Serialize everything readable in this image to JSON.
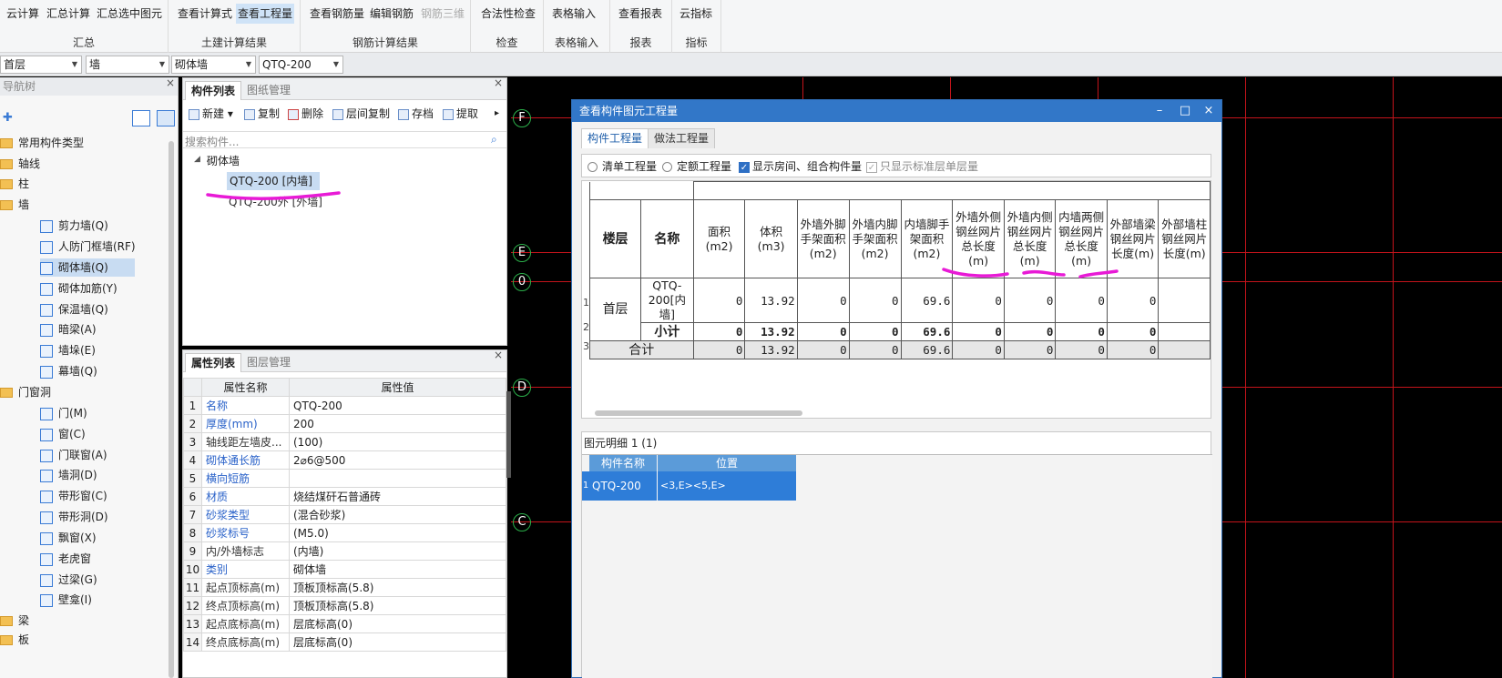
{
  "ribbon": {
    "groups": [
      {
        "label": "汇总",
        "buttons": [
          "云计算",
          "汇总计算",
          "汇总选中图元"
        ]
      },
      {
        "label": "土建计算结果",
        "buttons": [
          "查看计算式",
          "查看工程量"
        ]
      },
      {
        "label": "钢筋计算结果",
        "buttons": [
          "查看钢筋量",
          "编辑钢筋",
          "钢筋三维"
        ]
      },
      {
        "label": "检查",
        "buttons": [
          "合法性检查"
        ]
      },
      {
        "label": "表格输入",
        "buttons": [
          "表格输入"
        ]
      },
      {
        "label": "报表",
        "buttons": [
          "查看报表"
        ]
      },
      {
        "label": "指标",
        "buttons": [
          "云指标"
        ]
      }
    ]
  },
  "selectors": {
    "floor": "首层",
    "category": "墙",
    "type": "砌体墙",
    "component": "QTQ-200"
  },
  "nav": {
    "title": "导航树",
    "items": [
      "常用构件类型",
      "轴线",
      "柱",
      "墙",
      "剪力墙(Q)",
      "人防门框墙(RF)",
      "砌体墙(Q)",
      "砌体加筋(Y)",
      "保温墙(Q)",
      "暗梁(A)",
      "墙垛(E)",
      "幕墙(Q)",
      "门窗洞",
      "门(M)",
      "窗(C)",
      "门联窗(A)",
      "墙洞(D)",
      "带形窗(C)",
      "带形洞(D)",
      "飘窗(X)",
      "老虎窗",
      "过梁(G)",
      "壁龛(I)",
      "梁",
      "板"
    ]
  },
  "component_list": {
    "tab_active": "构件列表",
    "tab_other": "图纸管理",
    "toolbar": [
      "新建",
      "复制",
      "删除",
      "层间复制",
      "存档",
      "提取"
    ],
    "search_placeholder": "搜索构件...",
    "group": "砌体墙",
    "items": [
      "QTQ-200 [内墙]",
      "QTQ-200外 [外墙]"
    ]
  },
  "property_list": {
    "tab_active": "属性列表",
    "tab_other": "图层管理",
    "col_name": "属性名称",
    "col_value": "属性值",
    "rows": [
      {
        "n": "1",
        "k": "名称",
        "v": "QTQ-200"
      },
      {
        "n": "2",
        "k": "厚度(mm)",
        "v": "200"
      },
      {
        "n": "3",
        "k": "轴线距左墙皮...",
        "v": "(100)"
      },
      {
        "n": "4",
        "k": "砌体通长筋",
        "v": "2⌀6@500"
      },
      {
        "n": "5",
        "k": "横向短筋",
        "v": ""
      },
      {
        "n": "6",
        "k": "材质",
        "v": "烧结煤矸石普通砖"
      },
      {
        "n": "7",
        "k": "砂浆类型",
        "v": "(混合砂浆)"
      },
      {
        "n": "8",
        "k": "砂浆标号",
        "v": "(M5.0)"
      },
      {
        "n": "9",
        "k": "内/外墙标志",
        "v": "(内墙)"
      },
      {
        "n": "10",
        "k": "类别",
        "v": "砌体墙"
      },
      {
        "n": "11",
        "k": "起点顶标高(m)",
        "v": "顶板顶标高(5.8)"
      },
      {
        "n": "12",
        "k": "终点顶标高(m)",
        "v": "顶板顶标高(5.8)"
      },
      {
        "n": "13",
        "k": "起点底标高(m)",
        "v": "层底标高(0)"
      },
      {
        "n": "14",
        "k": "终点底标高(m)",
        "v": "层底标高(0)"
      }
    ]
  },
  "cad": {
    "axes": [
      "F",
      "E",
      "0",
      "D",
      "C"
    ]
  },
  "dialog": {
    "title": "查看构件图元工程量",
    "tabs": [
      "构件工程量",
      "做法工程量"
    ],
    "options": {
      "radio1": "清单工程量",
      "radio2": "定额工程量",
      "check1": "显示房间、组合构件量",
      "check2": "只显示标准层单层量"
    },
    "headers": [
      "楼层",
      "名称",
      "面积(m2)",
      "体积(m3)",
      "外墙外脚手架面积(m2)",
      "外墙内脚手架面积(m2)",
      "内墙脚手架面积(m2)",
      "外墙外侧钢丝网片总长度(m)",
      "外墙内侧钢丝网片总长度(m)",
      "内墙两侧钢丝网片总长度(m)",
      "外部墙梁钢丝网片长度(m)",
      "外部墙柱钢丝网片长度(m)"
    ],
    "rows": [
      {
        "floor": "首层",
        "name": "QTQ-200[内墙]",
        "vals": [
          "0",
          "13.92",
          "0",
          "0",
          "69.6",
          "0",
          "0",
          "0",
          "0",
          ""
        ]
      },
      {
        "name": "小计",
        "vals": [
          "0",
          "13.92",
          "0",
          "0",
          "69.6",
          "0",
          "0",
          "0",
          "0",
          ""
        ]
      },
      {
        "name": "合计",
        "vals": [
          "0",
          "13.92",
          "0",
          "0",
          "69.6",
          "0",
          "0",
          "0",
          "0",
          ""
        ]
      }
    ],
    "row_numbers": [
      "1",
      "2",
      "3"
    ],
    "detail": {
      "label": "图元明细  1 (1)",
      "col1": "构件名称",
      "col2": "位置",
      "row_num": "1",
      "name": "QTQ-200",
      "pos": "<3,E><5,E>"
    }
  },
  "colors": {
    "accent": "#3277c8",
    "grid": "#c4141b",
    "axis": "#2bb04a",
    "annotation": "#e81ad6"
  }
}
